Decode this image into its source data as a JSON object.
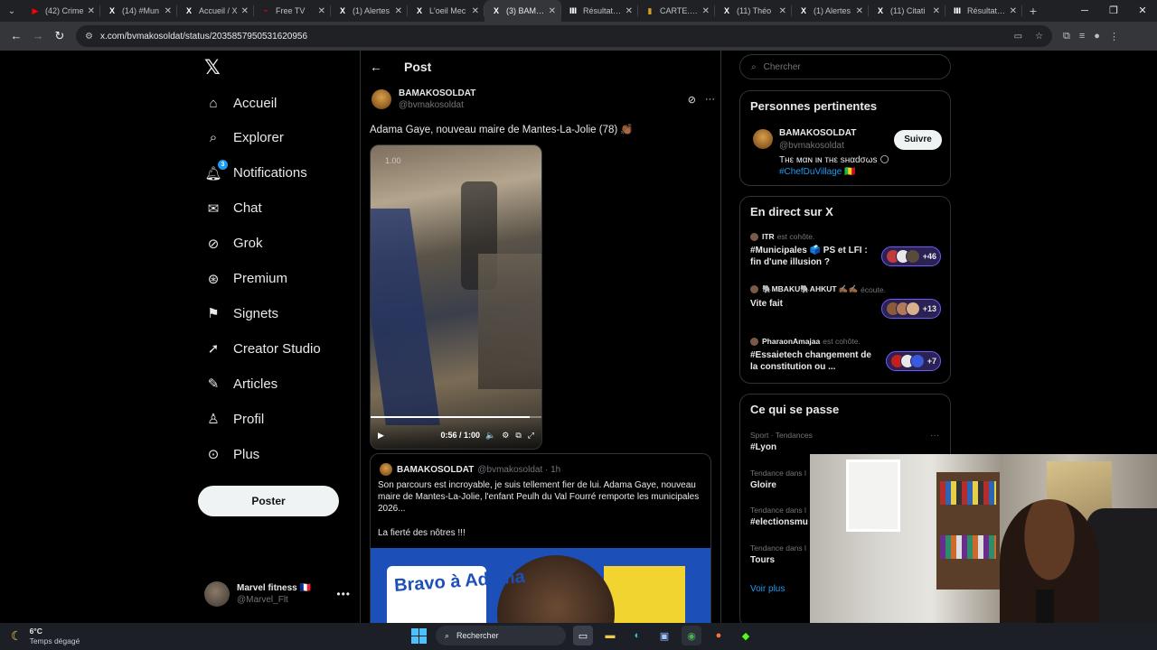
{
  "browser": {
    "tabs": [
      {
        "title": "(42) Crime",
        "icon": "youtube-icon",
        "color": "#ff0000",
        "active": false
      },
      {
        "title": "(14) #Mun",
        "icon": "x-icon",
        "color": "#ffffff",
        "active": false
      },
      {
        "title": "Accueil / X",
        "icon": "x-icon",
        "color": "#ffffff",
        "active": false
      },
      {
        "title": "Free TV",
        "icon": "free-icon",
        "color": "#e3001b",
        "active": false
      },
      {
        "title": "(1) Alertes",
        "icon": "x-icon",
        "color": "#ffffff",
        "active": false
      },
      {
        "title": "L'oeil Mec",
        "icon": "x-icon",
        "color": "#ffffff",
        "active": false
      },
      {
        "title": "(3) BAMAK",
        "icon": "x-icon",
        "color": "#ffffff",
        "active": true
      },
      {
        "title": "Résultats d",
        "icon": "results-icon",
        "color": "#ffffff",
        "active": false
      },
      {
        "title": "CARTE. Ré",
        "icon": "map-icon",
        "color": "#d4a017",
        "active": false
      },
      {
        "title": "(11) Théo",
        "icon": "x-icon",
        "color": "#ffffff",
        "active": false
      },
      {
        "title": "(1) Alertes",
        "icon": "x-icon",
        "color": "#ffffff",
        "active": false
      },
      {
        "title": "(11) Citati",
        "icon": "x-icon",
        "color": "#ffffff",
        "active": false
      },
      {
        "title": "Résultats d",
        "icon": "results-icon",
        "color": "#ffffff",
        "active": false
      }
    ],
    "url": "x.com/bvmakosoldat/status/2035857950531620956"
  },
  "nav": {
    "items": [
      {
        "label": "Accueil",
        "icon": "home-icon"
      },
      {
        "label": "Explorer",
        "icon": "search-icon"
      },
      {
        "label": "Notifications",
        "icon": "bell-icon",
        "badge": "3"
      },
      {
        "label": "Chat",
        "icon": "mail-icon"
      },
      {
        "label": "Grok",
        "icon": "grok-icon"
      },
      {
        "label": "Premium",
        "icon": "premium-icon"
      },
      {
        "label": "Signets",
        "icon": "bookmark-icon"
      },
      {
        "label": "Creator Studio",
        "icon": "rocket-icon"
      },
      {
        "label": "Articles",
        "icon": "article-icon"
      },
      {
        "label": "Profil",
        "icon": "person-icon"
      },
      {
        "label": "Plus",
        "icon": "more-circle-icon"
      }
    ],
    "post_button": "Poster",
    "account": {
      "name": "Marvel fitness 🇫🇷",
      "handle": "@Marvel_Flt"
    }
  },
  "post": {
    "header": "Post",
    "author_name": "BAMAKOSOLDAT",
    "author_handle": "@bvmakosoldat",
    "text": "Adama Gaye, nouveau maire de Mantes-La-Jolie (78) 👏🏾",
    "video": {
      "rate": "1.00",
      "time": "0:56 / 1:00",
      "progress": 0.93
    },
    "quote": {
      "author_name": "BAMAKOSOLDAT",
      "author_handle": "@bvmakosoldat · 1h",
      "text": "Son parcours est incroyable, je suis tellement fier de lui. Adama Gaye, nouveau maire de Mantes-La-Jolie, l'enfant Peulh du Val Fourré remporte les municipales 2026...",
      "text2": "La fierté des nôtres !!!",
      "image_text": "Bravo à Adama"
    }
  },
  "right": {
    "search_placeholder": "Chercher",
    "relevant": {
      "title": "Personnes pertinentes",
      "name": "BAMAKOSOLDAT",
      "handle": "@bvmakosoldat",
      "bio": "Tнε мαɴ ιɴ тнε ѕнαdσωѕ 🌕",
      "bio_tag": "#ChefDuVillage 🇲🇱",
      "follow": "Suivre"
    },
    "live": {
      "title": "En direct sur X",
      "items": [
        {
          "host": "ITR",
          "meta": "est cohôte.",
          "topic": "#Municipales 🗳️ PS et LFI : fin d'une illusion ?",
          "count": "+46"
        },
        {
          "host": "🐘MBAKU🐘AHKUT ✍🏾✍🏾",
          "meta": "écoute.",
          "topic": "Vite fait",
          "count": "+13"
        },
        {
          "host": "PharaonAmajaa",
          "meta": "est cohôte.",
          "topic": "#Essaietech changement de la constitution ou ...",
          "count": "+7"
        }
      ]
    },
    "trends": {
      "title": "Ce qui se passe",
      "items": [
        {
          "category": "Sport · Tendances",
          "name": "#Lyon"
        },
        {
          "category": "Tendance dans l",
          "name": "Gloire"
        },
        {
          "category": "Tendance dans l",
          "name": "#electionsmu"
        },
        {
          "category": "Tendance dans l",
          "name": "Tours"
        }
      ],
      "more": "Voir plus"
    }
  },
  "taskbar": {
    "temp": "6°C",
    "weather": "Temps dégagé",
    "search": "Rechercher"
  },
  "colors": {
    "accent": "#1d9bf0",
    "live_border": "#7856ff"
  }
}
